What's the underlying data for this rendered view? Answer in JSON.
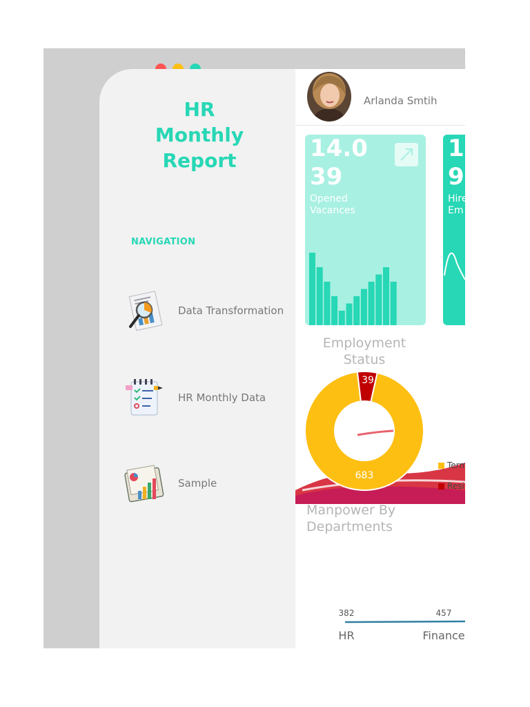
{
  "window": {
    "dots": [
      {
        "name": "close",
        "color": "#fc5554"
      },
      {
        "name": "minimize",
        "color": "#febf13"
      },
      {
        "name": "maximize",
        "color": "#27d7b5"
      }
    ]
  },
  "sidebar": {
    "title_lines": [
      "HR",
      "Monthly",
      "Report"
    ],
    "navigation_label": "NAVIGATION",
    "items": [
      {
        "label": "Data Transformation",
        "icon": "magnifier-report-icon"
      },
      {
        "label": "HR Monthly Data",
        "icon": "checklist-icon"
      },
      {
        "label": "Sample",
        "icon": "bar-chart-folder-icon"
      }
    ]
  },
  "header": {
    "user_name": "Arlanda Smtih"
  },
  "kpis": [
    {
      "value_lines": [
        "14.0",
        "39"
      ],
      "label_lines": [
        "Opened",
        "Vacances"
      ],
      "color": "#a8f0e2"
    },
    {
      "value_lines": [
        "1",
        "9"
      ],
      "label_lines": [
        "Hire",
        "Em"
      ],
      "color": "#27d7b5"
    }
  ],
  "colors": {
    "accent": "#27d7b5",
    "donut_main": "#febf13",
    "donut_secondary": "#c00000",
    "dept_line": "#2f7fa0"
  },
  "chart_data": [
    {
      "type": "bar",
      "title": "",
      "values": [
        100,
        80,
        60,
        40,
        20,
        30,
        40,
        50,
        60,
        70,
        80,
        60
      ]
    },
    {
      "type": "pie",
      "title": "Employment Status",
      "slices": [
        {
          "name": "Term",
          "value": 683,
          "color": "#febf13"
        },
        {
          "name": "Resi",
          "value": 39,
          "color": "#c00000"
        }
      ],
      "data_labels": [
        "683",
        "39"
      ],
      "legend_position": "right"
    },
    {
      "type": "line",
      "title": "Manpower By Departments",
      "categories": [
        "HR",
        "Finance"
      ],
      "values": [
        382,
        457
      ],
      "value_labels": [
        "382",
        "457"
      ]
    }
  ],
  "sections": {
    "employment_status_lines": [
      "Employment",
      "Status"
    ],
    "manpower_lines": [
      "Manpower By",
      "Departments"
    ]
  }
}
